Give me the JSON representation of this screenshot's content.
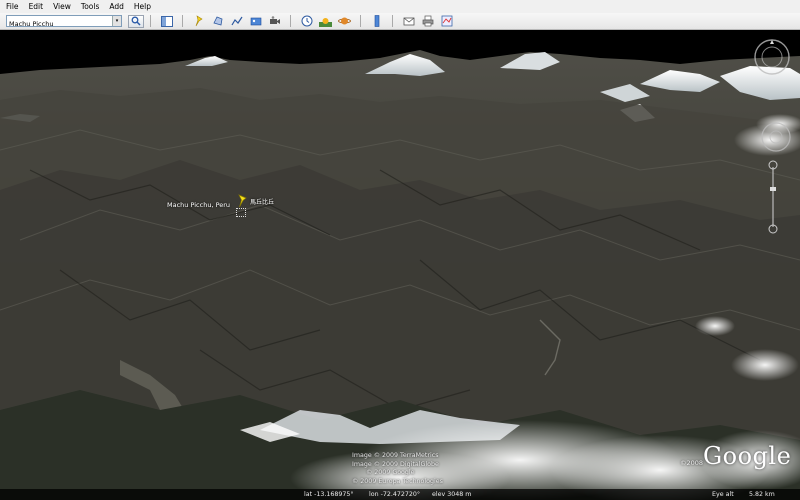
{
  "menu": [
    "File",
    "Edit",
    "View",
    "Tools",
    "Add",
    "Help"
  ],
  "search": {
    "value": "Machu Picchu",
    "dropdown_glyph": "▾"
  },
  "toolbar_icons": [
    "sidebar-toggle-icon",
    "add-placemark-icon",
    "add-polygon-icon",
    "add-path-icon",
    "add-image-overlay-icon",
    "record-tour-icon",
    "historical-imagery-icon",
    "sunlight-icon",
    "switch-planet-icon",
    "ruler-icon",
    "email-icon",
    "print-icon",
    "view-in-maps-icon"
  ],
  "placemark": {
    "label": "Machu Picchu, Peru",
    "secondary_label": "馬丘比丘"
  },
  "copyright": [
    "Image © 2009 TerraMetrics",
    "Image © 2009 DigitalGlobe",
    "© 2009 Google",
    "© 2009 Europa Technologies"
  ],
  "year_tag": "©2008",
  "logo": "Google",
  "status": {
    "lat": "lat  -13.168975°",
    "lon": "lon  -72.472720°",
    "elev": "elev  3048 m",
    "eye_alt_label": "Eye alt",
    "eye_alt_value": "5.82 km"
  },
  "colors": {
    "menubar": "#f0f0f0",
    "toolbar": "#e6e6e6",
    "sky": "#000000",
    "terrain_dark": "#2a2a26",
    "terrain_mid": "#4d4c44",
    "snow": "#e8ecee"
  }
}
